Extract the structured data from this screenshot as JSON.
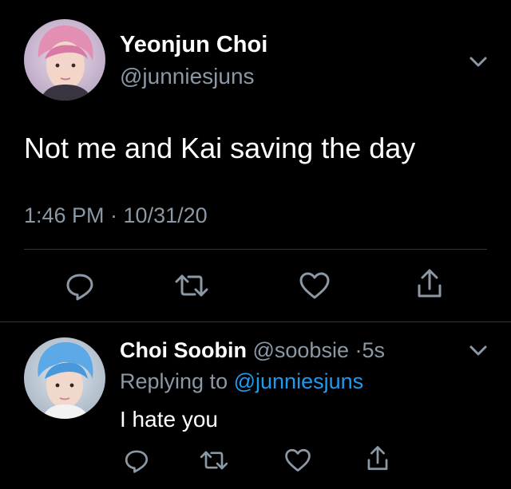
{
  "tweet": {
    "author_name": "Yeonjun Choi",
    "author_handle": "@junniesjuns",
    "text": "Not me and Kai saving the day",
    "timestamp": "1:46 PM · 10/31/20",
    "actions": [
      "reply-icon",
      "retweet-icon",
      "like-icon",
      "share-icon"
    ]
  },
  "reply": {
    "author_name": "Choi Soobin",
    "author_handle": "@soobsie",
    "time_sep": "·",
    "age": "5s",
    "replying_prefix": "Replying to",
    "replying_handle": "@junniesjuns",
    "text": "I hate you",
    "actions": [
      "reply-icon",
      "retweet-icon",
      "like-icon",
      "share-icon"
    ]
  },
  "colors": {
    "background": "#000000",
    "text": "#ffffff",
    "muted": "#8b98a5",
    "link": "#1d9bf0",
    "divider": "#2f3336"
  }
}
